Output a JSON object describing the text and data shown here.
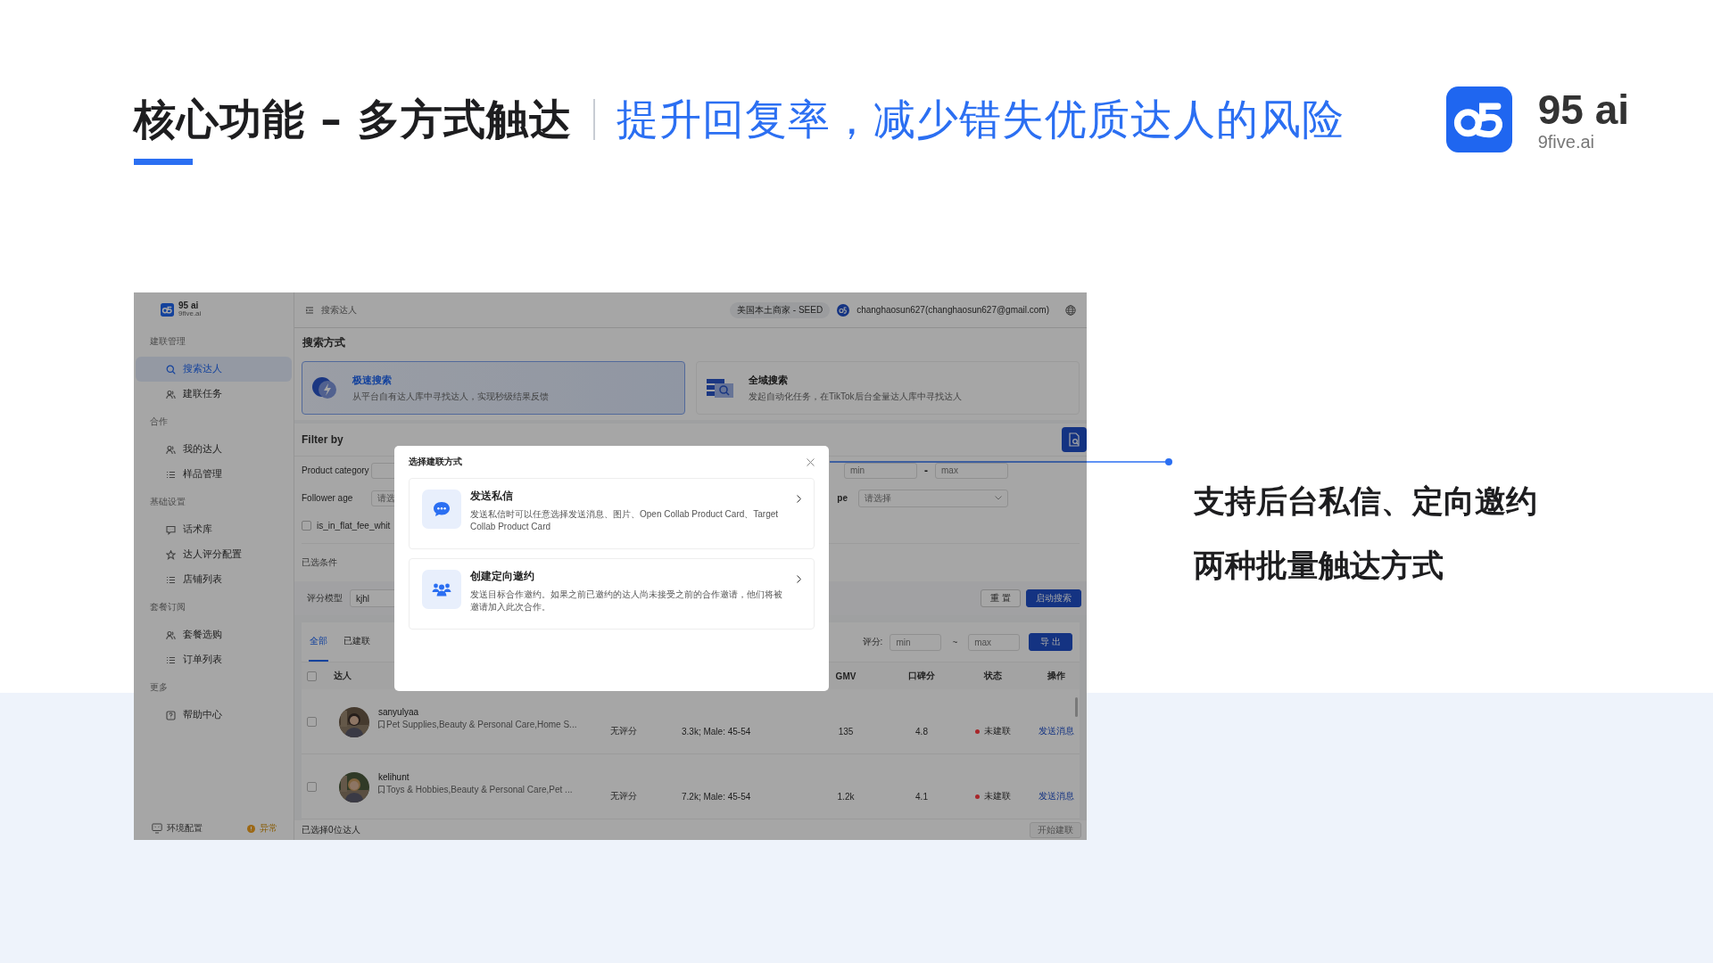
{
  "slide": {
    "title": "核心功能 – 多方式触达",
    "subtitle": "提升回复率，减少错失优质达人的风险",
    "brand": {
      "name": "95 ai",
      "domain": "9five.ai"
    },
    "callout": [
      "支持后台私信、定向邀约",
      "两种批量触达方式"
    ]
  },
  "app": {
    "sidebar": {
      "brand": {
        "name": "95 ai",
        "domain": "9five.ai"
      },
      "groups": [
        {
          "label": "建联管理",
          "items": [
            {
              "label": "搜索达人",
              "kind": "search",
              "selected": true
            },
            {
              "label": "建联任务",
              "kind": "users",
              "selected": false
            }
          ]
        },
        {
          "label": "合作",
          "items": [
            {
              "label": "我的达人",
              "kind": "users",
              "selected": false
            },
            {
              "label": "样品管理",
              "kind": "list",
              "selected": false
            }
          ]
        },
        {
          "label": "基础设置",
          "items": [
            {
              "label": "话术库",
              "kind": "chat",
              "selected": false
            },
            {
              "label": "达人评分配置",
              "kind": "star",
              "selected": false
            },
            {
              "label": "店铺列表",
              "kind": "list",
              "selected": false
            }
          ]
        },
        {
          "label": "套餐订阅",
          "items": [
            {
              "label": "套餐选购",
              "kind": "users",
              "selected": false
            },
            {
              "label": "订单列表",
              "kind": "list",
              "selected": false
            }
          ]
        },
        {
          "label": "更多",
          "items": [
            {
              "label": "帮助中心",
              "kind": "help",
              "selected": false
            }
          ]
        }
      ],
      "footer": {
        "label": "环境配置",
        "status": "异常"
      }
    },
    "topbar": {
      "breadcrumb": "搜索达人",
      "account_tag": "美国本土商家 - SEED",
      "user": "changhaosun627(changhaosun627@gmail.com)"
    },
    "search_methods": {
      "title": "搜索方式",
      "options": [
        {
          "title": "极速搜索",
          "description": "从平台自有达人库中寻找达人，实现秒级结果反馈",
          "kind": "fast",
          "selected": true
        },
        {
          "title": "全域搜索",
          "description": "发起自动化任务，在TikTok后台全量达人库中寻找达人",
          "kind": "global",
          "selected": false
        }
      ]
    },
    "filter": {
      "title": "Filter by",
      "product_category": {
        "label": "Product category"
      },
      "follower_age": {
        "label": "Follower age",
        "placeholder": "请选"
      },
      "range": {
        "min_placeholder": "min",
        "separator": "-",
        "max_placeholder": "max"
      },
      "select": {
        "label": "pe",
        "placeholder": "请选择"
      },
      "flat_fee": {
        "label": "is_in_flat_fee_whit",
        "checked": false
      },
      "selected_conditions": "已选条件",
      "score_model": {
        "label": "评分模型",
        "value": "kjhl"
      },
      "buttons": [
        {
          "label": "重 置",
          "kind": "default"
        },
        {
          "label": "启动搜索",
          "kind": "primary"
        }
      ]
    },
    "table": {
      "tabs": [
        {
          "label": "全部",
          "selected": true
        },
        {
          "label": "已建联",
          "selected": false
        }
      ],
      "score_range": {
        "label": "评分:",
        "min_placeholder": "min",
        "separator": "~",
        "max_placeholder": "max"
      },
      "export": "导 出",
      "select_all": {
        "checked": false
      },
      "columns": {
        "creator": "达人",
        "gmv": "GMV",
        "rating": "口碑分",
        "status": "状态",
        "action": "操作"
      },
      "rows": [
        {
          "checked": false,
          "name": "sanyulyaa",
          "categories": "Pet Supplies,Beauty & Personal Care,Home S...",
          "column_2": "无评分",
          "column_3": "3.3k; Male: 45-54",
          "gmv": "135",
          "rating": "4.8",
          "status": "未建联",
          "color": "#a8262a",
          "action": "发送消息"
        },
        {
          "checked": false,
          "name": "kelihunt",
          "categories": "Toys & Hobbies,Beauty & Personal Care,Pet ...",
          "column_2": "无评分",
          "column_3": "7.2k; Male: 45-54",
          "gmv": "1.2k",
          "rating": "4.1",
          "status": "未建联",
          "color": "#a8262a",
          "action": "发送消息"
        }
      ],
      "selected_count": "已选择0位达人",
      "start_button": {
        "label": "开始建联",
        "disabled": true
      }
    },
    "modal": {
      "title": "选择建联方式",
      "options": [
        {
          "title": "发送私信",
          "description": "发送私信时可以任意选择发送消息、图片、Open Collab Product Card、Target Collab Product Card",
          "kind": "message"
        },
        {
          "title": "创建定向邀约",
          "description": "发送目标合作邀约。如果之前已邀约的达人尚未接受之前的合作邀请，他们将被邀请加入此次合作。",
          "kind": "invite"
        }
      ]
    }
  }
}
